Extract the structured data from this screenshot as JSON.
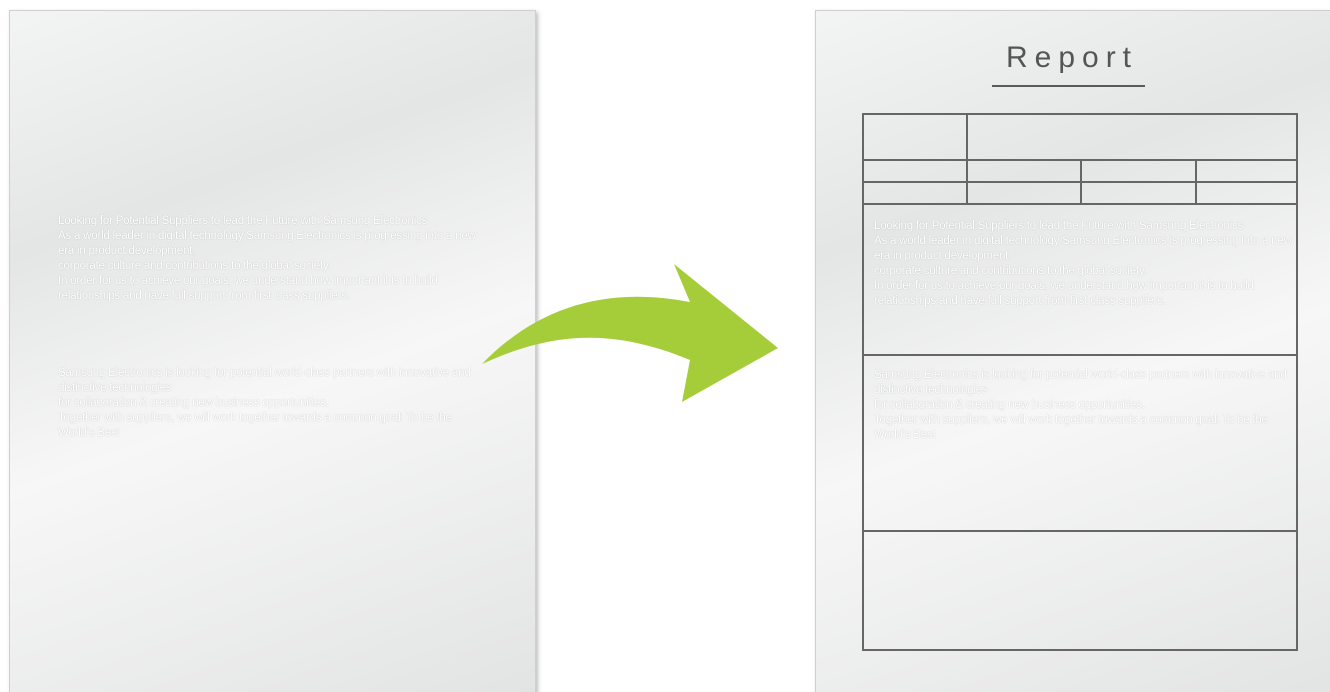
{
  "before_page": {
    "paragraph_1": [
      "Looking for Potential Suppliers to lead the Future with Samsung Electronics",
      "As a world leader in digital technology Samsung Electronics is progressing into a new era in product development,",
      "corporate culture and contributions to the global society.",
      "In order for us to achieve our goals, we understand how important it is to build relationships and have full support from first class suppliers."
    ],
    "paragraph_2": [
      "Samsung Electronics is looking for potential world-class partners with innovative and distinctive technologies",
      "for collaboration & creating new business opportunities.",
      "Together with suppliers, we will work together towards a common goal: To be the World's Best"
    ]
  },
  "after_page": {
    "title": "Report",
    "paragraph_1": [
      "Looking for Potential Suppliers to lead the Future with Samsung Electronics",
      "As a world leader in digital technology Samsung Electronics is progressing into a new era in product development,",
      "corporate culture and contributions to the global society.",
      "In order for us to achieve our goals, we understand how important it is to build relationships and have full support from first class suppliers."
    ],
    "paragraph_2": [
      "Samsung Electronics is looking for potential world-class partners with innovative and distinctive technologies",
      "for collaboration & creating new business opportunities.",
      "Together with suppliers, we will work together towards a common goal: To be the World's Best"
    ]
  },
  "colors": {
    "arrow": "#a5cd39",
    "form_lines": "#666666",
    "title": "#555555"
  },
  "icons": {
    "transform_arrow": "curved-arrow-icon"
  }
}
